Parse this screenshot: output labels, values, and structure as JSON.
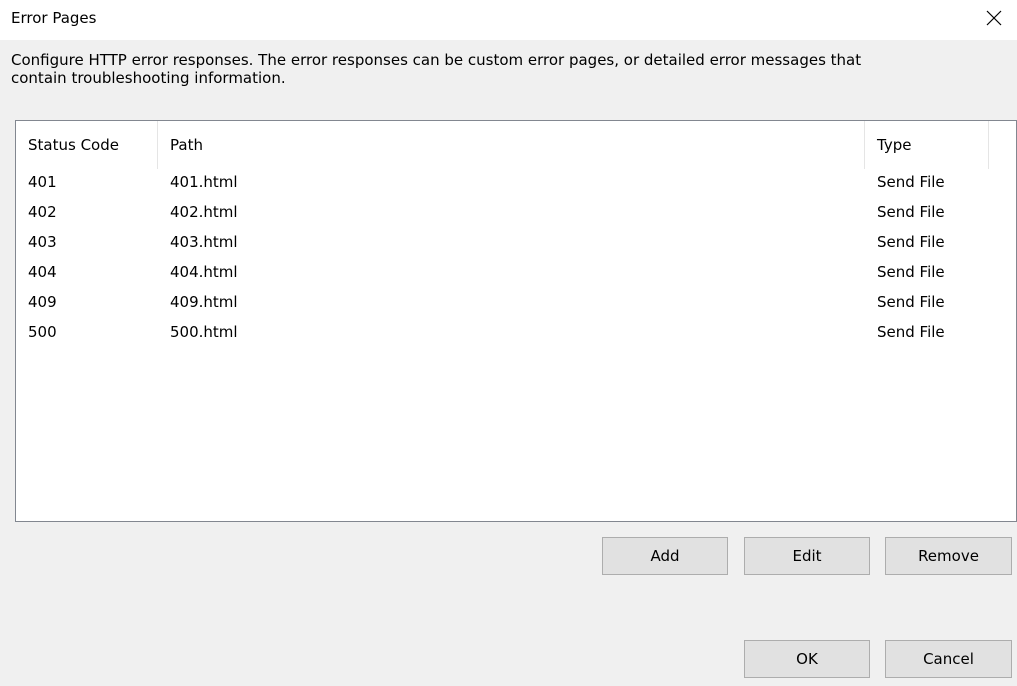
{
  "window": {
    "title": "Error Pages",
    "close_icon": "close-icon"
  },
  "description": "Configure HTTP error responses. The error responses can be custom error pages, or detailed error messages that\ncontain troubleshooting information.",
  "list": {
    "columns": [
      "Status Code",
      "Path",
      "Type"
    ],
    "rows": [
      {
        "status": "401",
        "path": "401.html",
        "type": "Send File"
      },
      {
        "status": "402",
        "path": "402.html",
        "type": "Send File"
      },
      {
        "status": "403",
        "path": "403.html",
        "type": "Send File"
      },
      {
        "status": "404",
        "path": "404.html",
        "type": "Send File"
      },
      {
        "status": "409",
        "path": "409.html",
        "type": "Send File"
      },
      {
        "status": "500",
        "path": "500.html",
        "type": "Send File"
      }
    ]
  },
  "buttons": {
    "add": "Add",
    "edit": "Edit",
    "remove": "Remove",
    "ok": "OK",
    "cancel": "Cancel"
  },
  "colors": {
    "dialog_bg": "#f0f0f0",
    "list_bg": "#ffffff",
    "list_border": "#828790",
    "button_bg": "#e1e1e1",
    "button_border": "#adadad"
  }
}
